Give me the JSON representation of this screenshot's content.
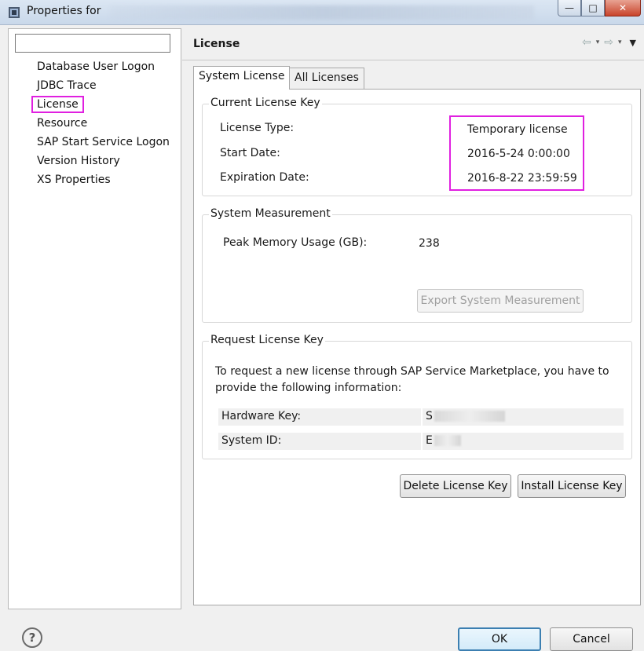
{
  "window": {
    "title": "Properties for",
    "minimize_glyph": "—",
    "maximize_glyph": "□",
    "close_glyph": "✕"
  },
  "tree": {
    "filter_placeholder": "",
    "items": [
      {
        "label": "Database User Logon"
      },
      {
        "label": "JDBC Trace"
      },
      {
        "label": "License"
      },
      {
        "label": "Resource"
      },
      {
        "label": "SAP Start Service Logon"
      },
      {
        "label": "Version History"
      },
      {
        "label": "XS Properties"
      }
    ],
    "selected_index": 2
  },
  "page": {
    "title": "License",
    "nav": {
      "back": "⇦",
      "forward": "⇨",
      "dropdown": "▾",
      "menu": "▼"
    }
  },
  "tabs": [
    {
      "label": "System License",
      "active": true
    },
    {
      "label": "All Licenses",
      "active": false
    }
  ],
  "current_license": {
    "title": "Current License Key",
    "type_label": "License Type:",
    "type_value": "Temporary license",
    "start_label": "Start Date:",
    "start_value": "2016-5-24 0:00:00",
    "expiration_label": "Expiration Date:",
    "expiration_value": "2016-8-22 23:59:59"
  },
  "measurement": {
    "title": "System Measurement",
    "peak_label": "Peak Memory Usage (GB):",
    "peak_value": "238",
    "export_button": "Export System Measurement"
  },
  "request": {
    "title": "Request License Key",
    "description": "To request a new license through SAP Service Marketplace, you have to provide the following information:",
    "hardware_label": "Hardware Key:",
    "hardware_value": "S",
    "system_label": "System ID:",
    "system_value": "E"
  },
  "buttons": {
    "delete": "Delete License Key",
    "install": "Install License Key",
    "ok": "OK",
    "cancel": "Cancel",
    "help": "?"
  },
  "colors": {
    "highlight": "#e020e0",
    "ok_border": "#3c7fb1"
  }
}
